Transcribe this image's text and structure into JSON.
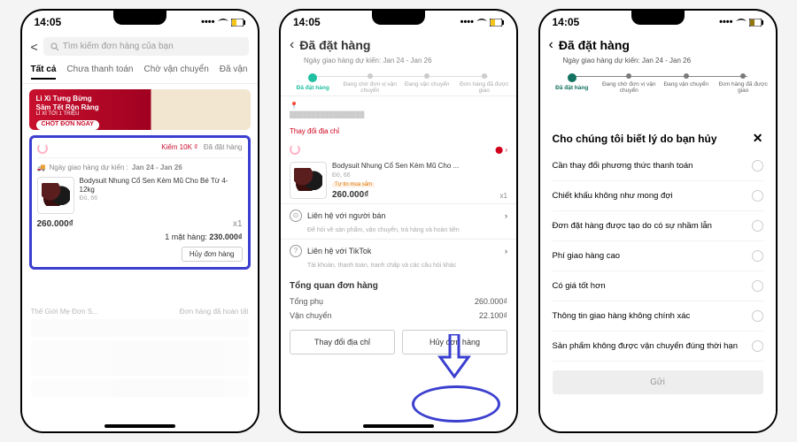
{
  "status": {
    "time": "14:05",
    "wifi": "􀙇",
    "battery_low": true
  },
  "s1": {
    "back": "<",
    "search_placeholder": "Tìm kiếm đơn hàng của bạn",
    "tabs": {
      "all": "Tất cả",
      "unpaid": "Chưa thanh toán",
      "shipping": "Chờ vận chuyển",
      "delivering": "Đã vận"
    },
    "banner": {
      "l1": "Lì Xì Tưng Bừng",
      "l2": "Săm Tết Rộn Ràng",
      "l3": "LÌ XÌ TỚI 1 TRIỆU",
      "btn": "CHỐT ĐƠN NGAY"
    },
    "card": {
      "coupon": "Kiếm 10K ₫",
      "status": "Đã đặt hàng",
      "delivery_label": "Ngày giao hàng dự kiến :",
      "delivery_range": "Jan 24 - Jan 26",
      "item_name": "Bodysuit Nhung Cổ Sen Kèm Mũ Cho Bé Từ 4-12kg",
      "variant": "Đỏ, 66",
      "price": "260.000₫",
      "qty": "x1",
      "total_label": "1 mặt hàng:",
      "total": "230.000₫",
      "cancel": "Hủy đơn hàng"
    },
    "faded_hdr1": "Thế Giới Mẹ Đơn S...",
    "faded_hdr2": "Đơn hàng đã hoàn tất"
  },
  "s2": {
    "title": "Đã đặt hàng",
    "subtitle": "Ngày giao hàng dự kiến: Jan 24 - Jan 26",
    "steps": {
      "s1": "Đã đặt hàng",
      "s2": "Đang chờ đơn vị vận chuyển",
      "s3": "Đang vận chuyển",
      "s4": "Đơn hàng đã được giao"
    },
    "addr_icon": "📍",
    "change_addr": "Thay đổi địa chỉ",
    "item_name": "Bodysuit Nhung Cổ Sen Kèm Mũ Cho ...",
    "variant": "Đỏ, 66",
    "trust": "Tự tin mua sắm",
    "price": "260.000₫",
    "qty": "x1",
    "contact_seller": "Liên hệ với người bán",
    "contact_seller_sub": "Để hỏi về sản phẩm, vận chuyển, trả hàng và hoàn tiền",
    "contact_tiktok": "Liên hệ với TikTok",
    "contact_tiktok_sub": "Tài khoản, thanh toán, tranh chấp và các câu hỏi khác",
    "summary": "Tổng quan đơn hàng",
    "subtotal_label": "Tổng phụ",
    "subtotal": "260.000₫",
    "shipping_label": "Vận chuyển",
    "shipping": "22.100₫",
    "btn_change_addr": "Thay đổi địa chỉ",
    "btn_cancel": "Hủy đơn hàng"
  },
  "s3": {
    "title": "Cho chúng tôi biết lý do bạn hủy",
    "reasons": [
      "Cần thay đổi phương thức thanh toán",
      "Chiết khấu không như mong đợi",
      "Đơn đặt hàng được tạo do có sự nhầm lẫn",
      "Phí giao hàng cao",
      "Có giá tốt hơn",
      "Thông tin giao hàng không chính xác",
      "Sản phẩm không được vận chuyển đúng thời hạn"
    ],
    "submit": "Gửi"
  }
}
